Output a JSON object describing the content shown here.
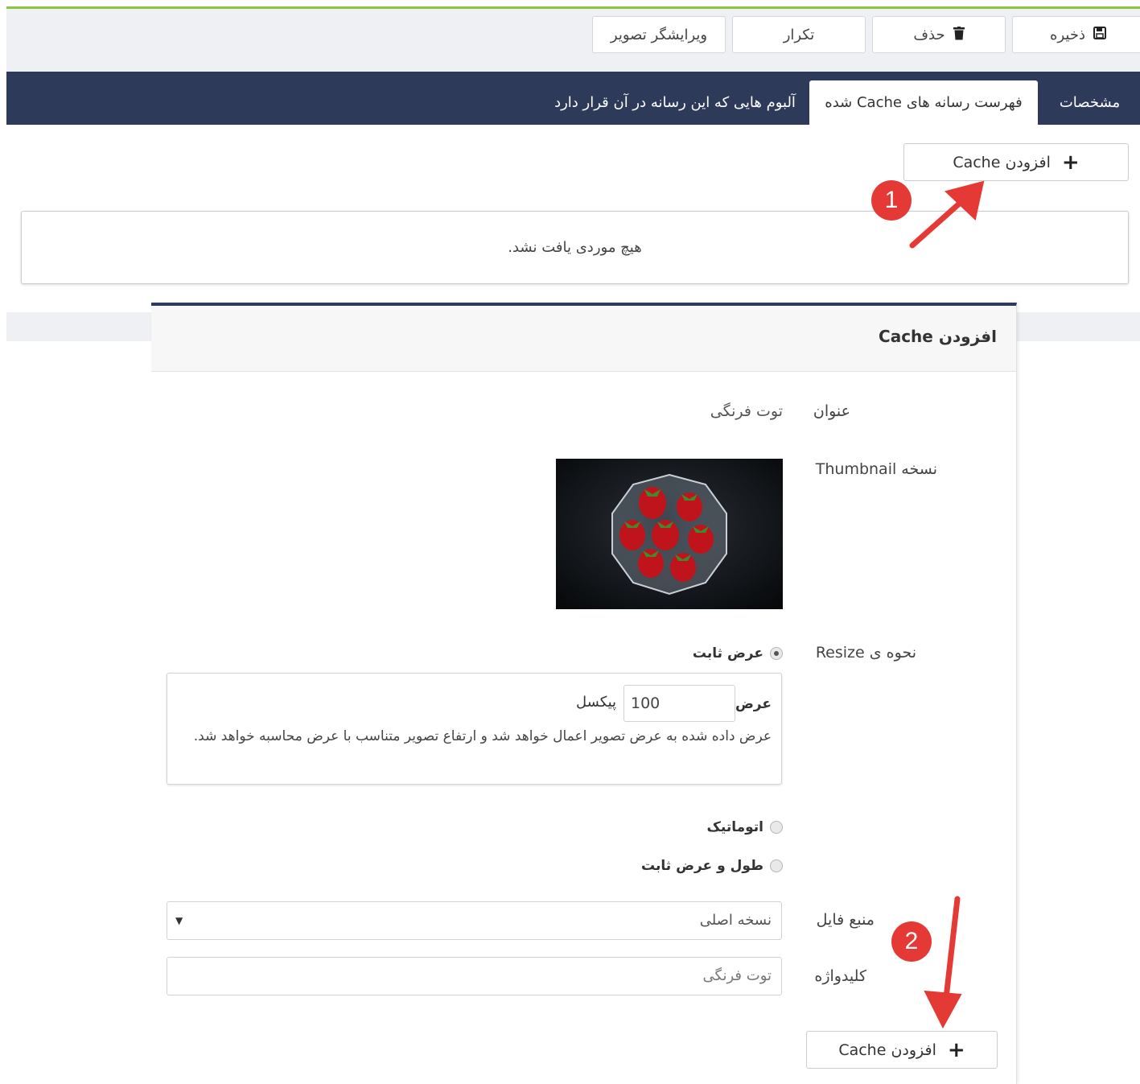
{
  "toolbar": {
    "save_label": "ذخیره",
    "delete_label": "حذف",
    "duplicate_label": "تکرار",
    "image_editor_label": "ویرایشگر تصویر"
  },
  "tabs": [
    {
      "label": "مشخصات",
      "active": false
    },
    {
      "label": "فهرست رسانه های Cache شده",
      "active": true
    },
    {
      "label": "آلبوم هایی که این رسانه در آن قرار دارد",
      "active": false
    }
  ],
  "cache_list": {
    "add_button_label": "افزودن Cache",
    "empty_message": "هیچ موردی یافت نشد."
  },
  "modal": {
    "title": "افزودن Cache",
    "title_label": "عنوان",
    "title_value": "توت فرنگی",
    "thumbnail_label": "نسخه Thumbnail",
    "resize_label": "نحوه ی Resize",
    "resize_options": [
      "عرض ثابت",
      "اتوماتیک",
      "طول و عرض ثابت"
    ],
    "resize_selected": "عرض ثابت",
    "width_label": "عرض",
    "width_value": "100",
    "width_unit": "پیکسل",
    "width_help": "عرض داده شده به عرض تصویر اعمال خواهد شد و ارتفاع تصویر متناسب با عرض محاسبه خواهد شد.",
    "file_source_label": "منبع فایل",
    "file_source_value": "نسخه اصلی",
    "keyword_label": "کلیدواژه",
    "keyword_placeholder": "توت فرنگی",
    "submit_label": "افزودن Cache"
  },
  "annotations": {
    "badge_1": "1",
    "badge_2": "2",
    "color": "#e53935"
  },
  "colors": {
    "nav_bar": "#2e3a59",
    "accent_line": "#8cc63f"
  }
}
